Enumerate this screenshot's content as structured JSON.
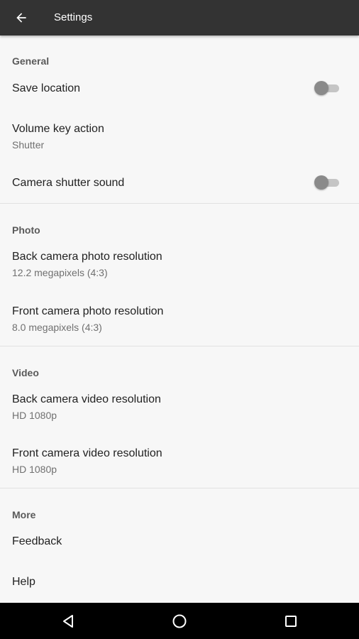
{
  "appbar": {
    "title": "Settings",
    "back_icon": "arrow-back-icon",
    "background": "#333333"
  },
  "sections": {
    "general": {
      "header": "General",
      "save_location": {
        "title": "Save location",
        "enabled": false
      },
      "volume_key_action": {
        "title": "Volume key action",
        "value": "Shutter"
      },
      "camera_shutter_sound": {
        "title": "Camera shutter sound",
        "enabled": false
      }
    },
    "photo": {
      "header": "Photo",
      "back_camera_photo_resolution": {
        "title": "Back camera photo resolution",
        "value": "12.2 megapixels (4:3)"
      },
      "front_camera_photo_resolution": {
        "title": "Front camera photo resolution",
        "value": "8.0 megapixels (4:3)"
      }
    },
    "video": {
      "header": "Video",
      "back_camera_video_resolution": {
        "title": "Back camera video resolution",
        "value": "HD 1080p"
      },
      "front_camera_video_resolution": {
        "title": "Front camera video resolution",
        "value": "HD 1080p"
      }
    },
    "more": {
      "header": "More",
      "feedback": {
        "title": "Feedback"
      },
      "help": {
        "title": "Help"
      }
    }
  },
  "navbar": {
    "back_icon": "nav-back-triangle-icon",
    "home_icon": "nav-home-circle-icon",
    "recents_icon": "nav-recents-square-icon"
  }
}
